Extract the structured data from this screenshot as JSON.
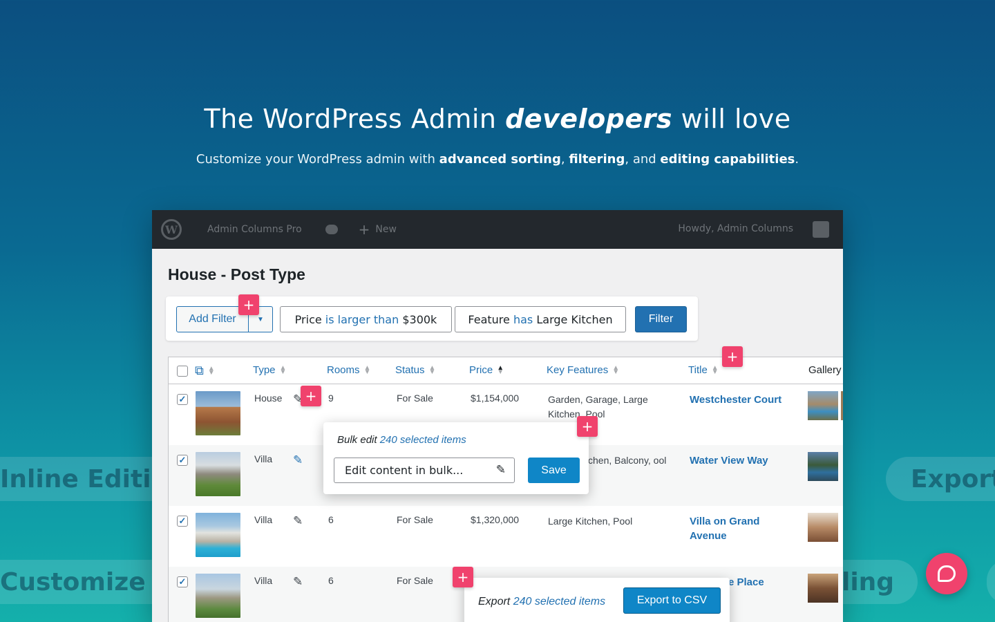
{
  "hero": {
    "title_pre": "The WordPress Admin ",
    "title_em": "developers",
    "title_post": " will love",
    "sub_pre": "Customize your WordPress admin with ",
    "sub_b1": "advanced sorting",
    "sub_c1": ", ",
    "sub_b2": "filtering",
    "sub_c2": ", and ",
    "sub_b3": "editing capabilities",
    "sub_end": "."
  },
  "pills": {
    "inline": "Inline Editing",
    "export": "Export",
    "customize": "Customize Tables",
    "ling": "ling"
  },
  "adminbar": {
    "site": "Admin Columns Pro",
    "new": "New",
    "howdy": "Howdy, Admin Columns",
    "new_icon": "+"
  },
  "page": {
    "title": "House - Post Type"
  },
  "filters": {
    "add_label": "Add Filter",
    "chips": [
      {
        "field": "Price",
        "op": "is larger than",
        "value": "$300k"
      },
      {
        "field": "Feature",
        "op": "has",
        "value": "Large Kitchen"
      }
    ],
    "button": "Filter"
  },
  "table": {
    "columns": [
      "Type",
      "Rooms",
      "Status",
      "Price",
      "Key Features",
      "Title",
      "Gallery"
    ],
    "rows": [
      {
        "type": "House",
        "rooms": "9",
        "status": "For Sale",
        "price": "$1,154,000",
        "features": "Garden, Garage, Large Kitchen, Pool",
        "title": "Westchester Court"
      },
      {
        "type": "Villa",
        "rooms": "",
        "status": "",
        "price": "",
        "features": "chen, Balcony, ool",
        "title": "Water View Way"
      },
      {
        "type": "Villa",
        "rooms": "6",
        "status": "For Sale",
        "price": "$1,320,000",
        "features": "Large Kitchen, Pool",
        "title": "Villa on Grand Avenue"
      },
      {
        "type": "Villa",
        "rooms": "6",
        "status": "For Sale",
        "price": "",
        "features": "",
        "title": "e Place"
      }
    ]
  },
  "bulk": {
    "prefix": "Bulk edit ",
    "count": "240 selected items",
    "input_value": "Edit content in bulk...",
    "save": "Save"
  },
  "export": {
    "prefix": "Export ",
    "count": "240 selected items",
    "button": "Export to CSV"
  },
  "colors": {
    "accent": "#2271b1",
    "plus": "#f0426d",
    "adminbar": "#23282d"
  }
}
